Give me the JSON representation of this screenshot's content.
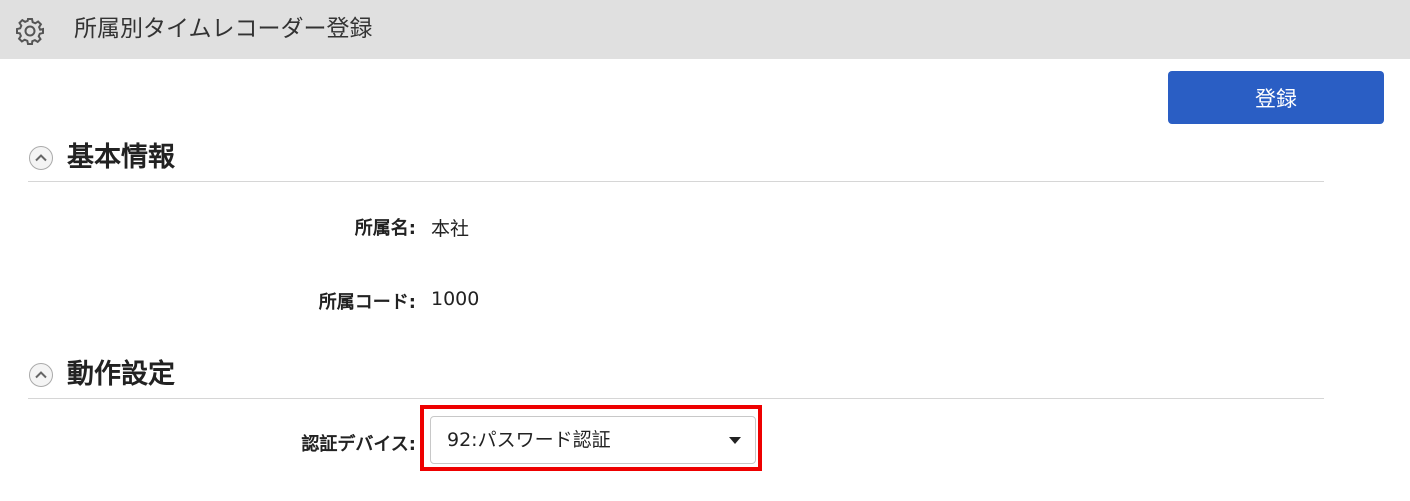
{
  "header": {
    "title": "所属別タイムレコーダー登録",
    "icon": "gear-icon"
  },
  "toolbar": {
    "register_label": "登録",
    "register_color": "#2a5ec4"
  },
  "sections": [
    {
      "title": "基本情報",
      "icon": "chevron-up-icon"
    },
    {
      "title": "動作設定",
      "icon": "chevron-up-icon"
    }
  ],
  "fields": {
    "dept_name": {
      "label": "所属名:",
      "value": "本社"
    },
    "dept_code": {
      "label": "所属コード:",
      "value": "1000"
    },
    "auth_device": {
      "label": "認証デバイス:",
      "selected": "92:パスワード認証",
      "highlight_color": "#ee0000"
    }
  }
}
